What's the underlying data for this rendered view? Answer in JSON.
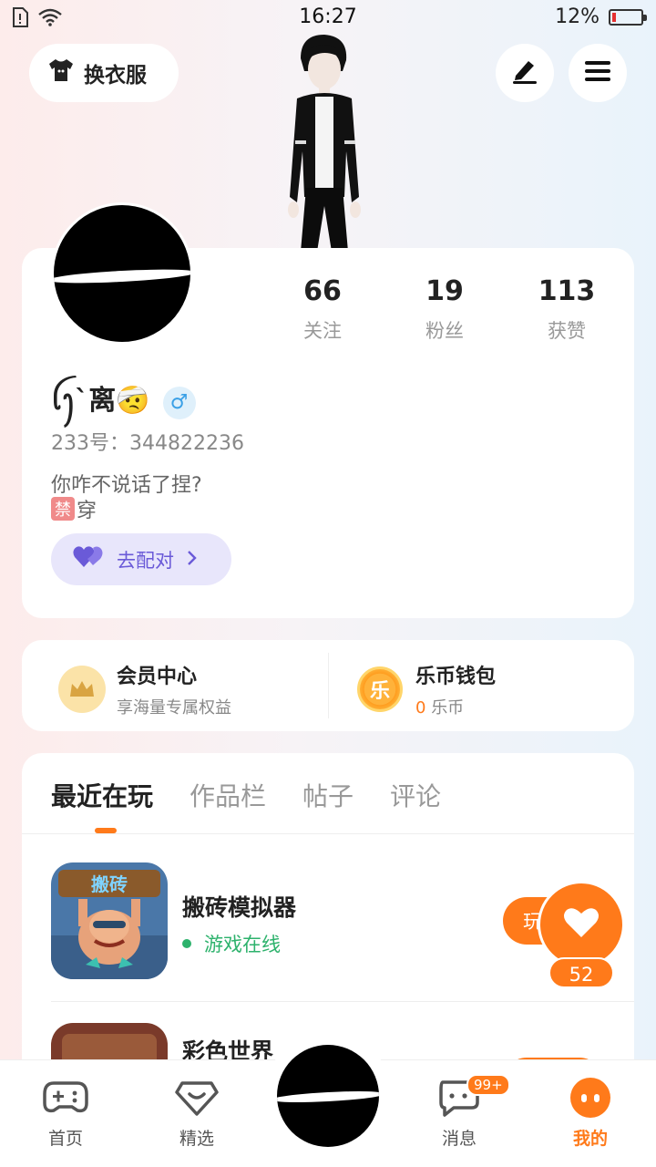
{
  "status_bar": {
    "time": "16:27",
    "battery_text": "12%",
    "battery_level": 0.12
  },
  "header": {
    "dress_label": "换衣服"
  },
  "profile": {
    "stats": [
      {
        "value": "66",
        "label": "关注"
      },
      {
        "value": "19",
        "label": "粉丝"
      },
      {
        "value": "113",
        "label": "获赞"
      }
    ],
    "nickname": "ꪶꫂ`离🤕",
    "gender_symbol": "♂",
    "uid": "233号：344822236",
    "bio_line1": "你咋不说话了捏?",
    "bio_line2_tag": "禁",
    "bio_line2_text": "穿",
    "match_label": "去配对"
  },
  "vip": {
    "member_title": "会员中心",
    "member_sub": "享海量专属权益",
    "wallet_title": "乐币钱包",
    "wallet_icon": "乐",
    "wallet_amount": "0",
    "wallet_unit": "乐币"
  },
  "tabs": [
    "最近在玩",
    "作品栏",
    "帖子",
    "评论"
  ],
  "games": [
    {
      "name": "搬砖模拟器",
      "status": "游戏在线",
      "play_label": "玩",
      "icon_text": "搬砖"
    },
    {
      "name": "彩色世界"
    }
  ],
  "like": {
    "count": "52"
  },
  "nav": {
    "home": "首页",
    "select": "精选",
    "messages": "消息",
    "messages_badge": "99+",
    "me": "我的"
  },
  "colors": {
    "accent": "#ff7a1a",
    "online": "#2db26c",
    "match": "#6a5ad8"
  }
}
